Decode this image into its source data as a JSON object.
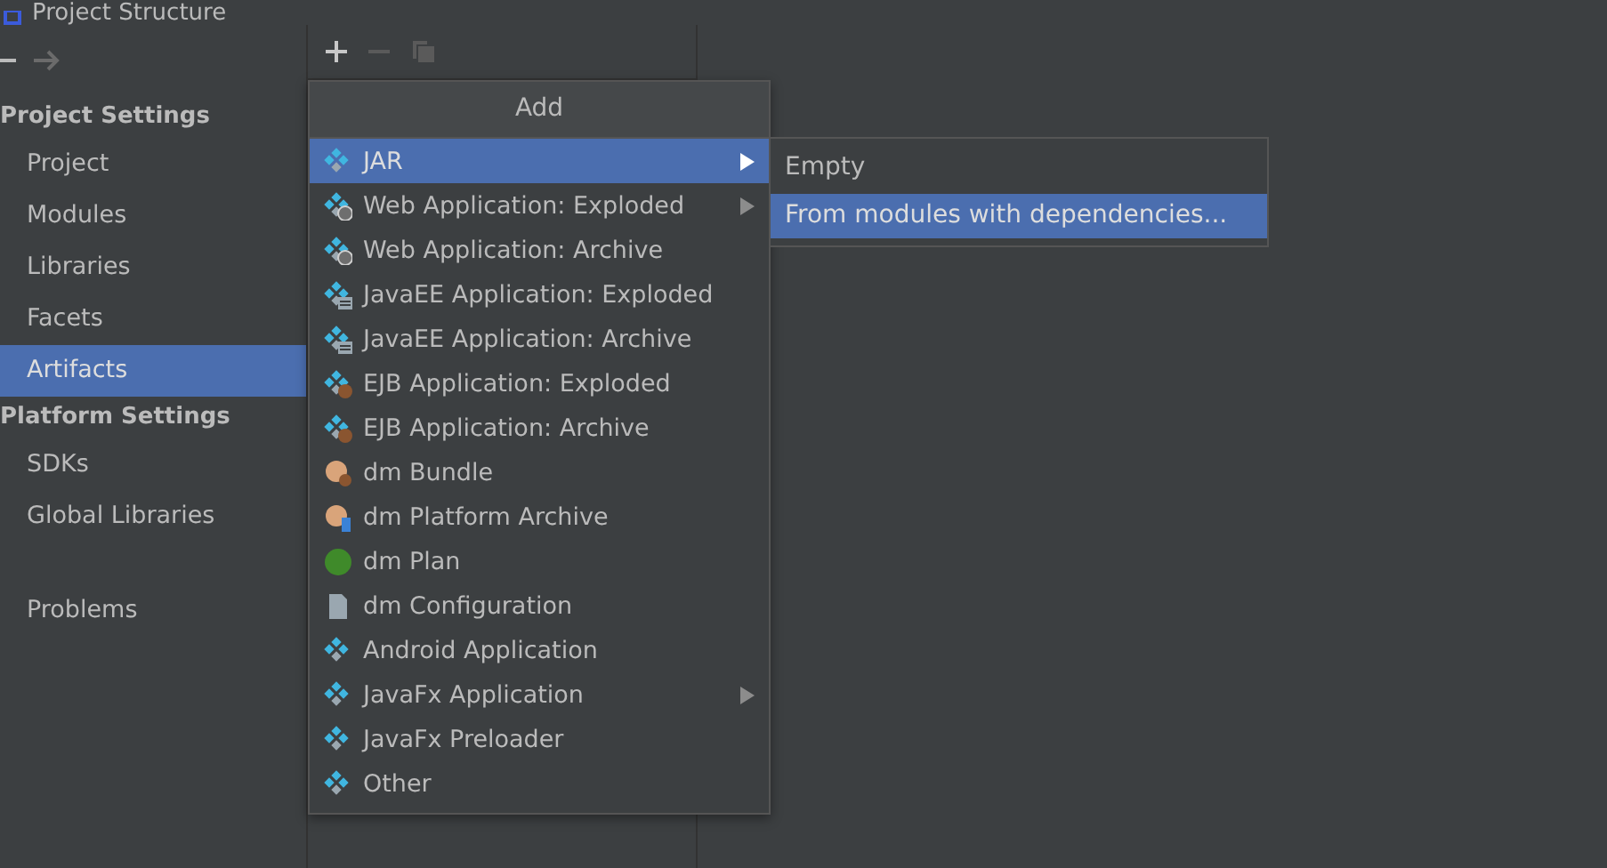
{
  "window": {
    "title": "Project Structure"
  },
  "sidebar": {
    "sections": [
      {
        "heading": "Project Settings",
        "items": [
          {
            "label": "Project",
            "selected": false
          },
          {
            "label": "Modules",
            "selected": false
          },
          {
            "label": "Libraries",
            "selected": false
          },
          {
            "label": "Facets",
            "selected": false
          },
          {
            "label": "Artifacts",
            "selected": true
          }
        ]
      },
      {
        "heading": "Platform Settings",
        "items": [
          {
            "label": "SDKs",
            "selected": false
          },
          {
            "label": "Global Libraries",
            "selected": false
          }
        ]
      },
      {
        "items": [
          {
            "label": "Problems",
            "selected": false
          }
        ]
      }
    ]
  },
  "toolbar": {
    "add_enabled": true,
    "remove_enabled": false,
    "copy_enabled": false
  },
  "add_menu": {
    "title": "Add",
    "items": [
      {
        "label": "JAR",
        "kind": "artifact",
        "submenu": true,
        "selected": true
      },
      {
        "label": "Web Application: Exploded",
        "kind": "web",
        "submenu": true,
        "selected": false
      },
      {
        "label": "Web Application: Archive",
        "kind": "web",
        "submenu": false,
        "selected": false
      },
      {
        "label": "JavaEE Application: Exploded",
        "kind": "javaee",
        "submenu": false,
        "selected": false
      },
      {
        "label": "JavaEE Application: Archive",
        "kind": "javaee",
        "submenu": false,
        "selected": false
      },
      {
        "label": "EJB Application: Exploded",
        "kind": "ejb",
        "submenu": false,
        "selected": false
      },
      {
        "label": "EJB Application: Archive",
        "kind": "ejb",
        "submenu": false,
        "selected": false
      },
      {
        "label": "dm Bundle",
        "kind": "bundle",
        "submenu": false,
        "selected": false
      },
      {
        "label": "dm Platform Archive",
        "kind": "platform",
        "submenu": false,
        "selected": false
      },
      {
        "label": "dm Plan",
        "kind": "plan",
        "submenu": false,
        "selected": false
      },
      {
        "label": "dm Configuration",
        "kind": "config",
        "submenu": false,
        "selected": false
      },
      {
        "label": "Android Application",
        "kind": "artifact",
        "submenu": false,
        "selected": false
      },
      {
        "label": "JavaFx Application",
        "kind": "artifact",
        "submenu": true,
        "selected": false
      },
      {
        "label": "JavaFx Preloader",
        "kind": "artifact",
        "submenu": false,
        "selected": false
      },
      {
        "label": "Other",
        "kind": "artifact",
        "submenu": false,
        "selected": false
      }
    ]
  },
  "jar_submenu": {
    "items": [
      {
        "label": "Empty",
        "selected": false
      },
      {
        "label": "From modules with dependencies...",
        "selected": true
      }
    ]
  }
}
